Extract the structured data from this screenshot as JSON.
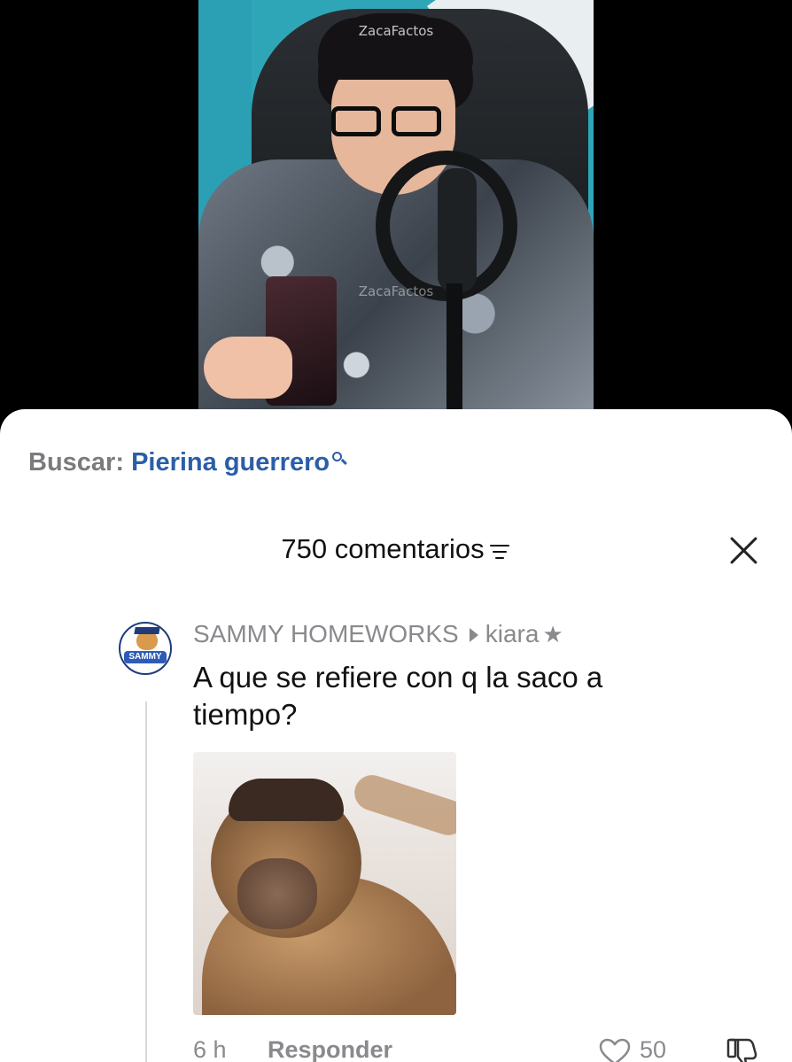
{
  "video": {
    "watermark_top": "ZacaFactos",
    "watermark_mid": "ZacaFactos"
  },
  "search": {
    "prefix": "Buscar:",
    "query": "Pierina guerrero"
  },
  "comments_header": {
    "count_label": "750 comentarios"
  },
  "comment": {
    "author": "SAMMY HOMEWORKS",
    "reply_to": "kiara",
    "avatar_text": "SAMMY",
    "text": "A que se refiere con q la saco a tiempo?",
    "time": "6 h",
    "reply_label": "Responder",
    "likes": "50"
  },
  "colors": {
    "search_blue": "#2b5ea7",
    "muted_gray": "#8a8a8e",
    "text_dark": "#111111"
  },
  "icons": [
    "search-icon",
    "filter-icon",
    "close-icon",
    "reply-arrow-icon",
    "star-icon",
    "heart-icon",
    "dislike-icon"
  ]
}
